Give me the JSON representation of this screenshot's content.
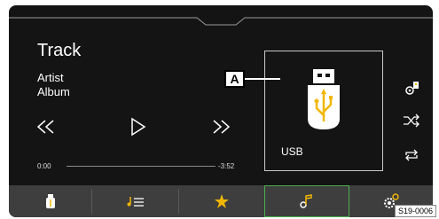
{
  "player": {
    "track": "Track",
    "artist": "Artist",
    "album": "Album",
    "elapsed": "0:00",
    "remaining": "-3:52",
    "progress": 0.0
  },
  "controls": {
    "previous_icon": "previous-track-icon",
    "play_icon": "play-icon",
    "next_icon": "next-track-icon"
  },
  "source": {
    "label": "USB",
    "icon": "usb-stick-icon"
  },
  "callout": {
    "label": "A"
  },
  "side_actions": {
    "items": [
      "audio-settings-icon",
      "shuffle-icon",
      "repeat-icon"
    ]
  },
  "bottom_tabs": {
    "items": [
      "usb-source-icon",
      "playlist-icon",
      "favorites-star-icon",
      "music-note-icon",
      "sound-settings-icon"
    ],
    "active_index": 3
  },
  "figure_code": "S19-0006",
  "colors": {
    "background": "#141414",
    "bar": "#3e3e3e",
    "accent_yellow": "#f2b705",
    "active_green": "#4caf50"
  }
}
